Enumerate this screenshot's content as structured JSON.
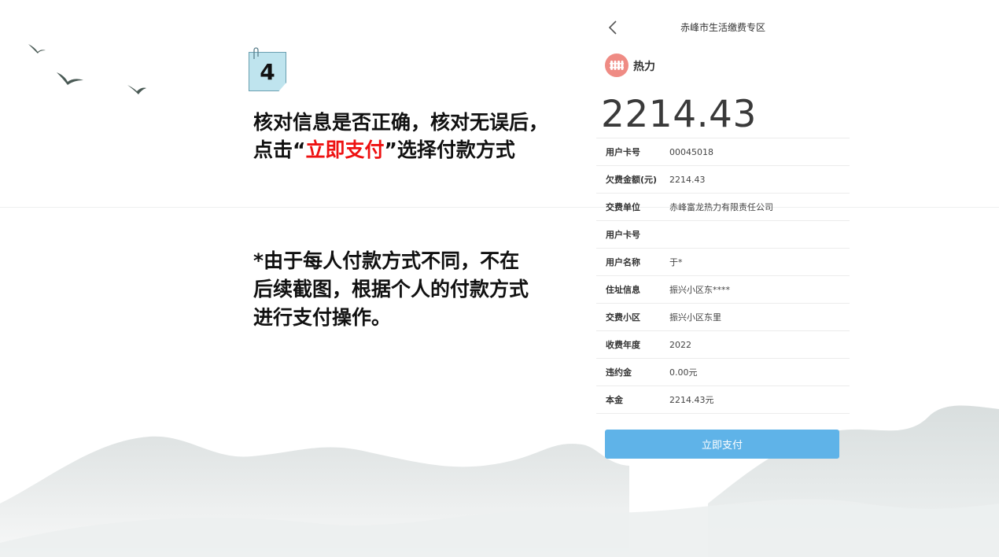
{
  "step": {
    "number": "4"
  },
  "instruction": {
    "line1": "核对信息是否正确，核对无误后，",
    "line2_prefix": "点击“",
    "line2_highlight": "立即支付",
    "line2_suffix": "”选择付款方式"
  },
  "note": {
    "line1": "*由于每人付款方式不同，不在",
    "line2": "后续截图，根据个人的付款方式",
    "line3": "进行支付操作。"
  },
  "app": {
    "title": "赤峰市生活缴费专区",
    "service_name": "热力",
    "amount": "2214.43",
    "rows": [
      {
        "label": "用户卡号",
        "value": "00045018"
      },
      {
        "label": "欠费金额(元)",
        "value": "2214.43"
      },
      {
        "label": "交费单位",
        "value": "赤峰富龙热力有限责任公司"
      },
      {
        "label": "用户卡号",
        "value": ""
      },
      {
        "label": "用户名称",
        "value": "于*"
      },
      {
        "label": "住址信息",
        "value": "振兴小区东****"
      },
      {
        "label": "交费小区",
        "value": "振兴小区东里"
      },
      {
        "label": "收费年度",
        "value": "2022"
      },
      {
        "label": "违约金",
        "value": "0.00元"
      },
      {
        "label": "本金",
        "value": "2214.43元"
      }
    ],
    "pay_button": "立即支付"
  },
  "colors": {
    "highlight": "#ee1111",
    "pay_button": "#5fb3e8",
    "service_icon": "#ef8b84",
    "note_paper": "#bfe4ee"
  },
  "icons": {
    "back": "chevron-left-icon",
    "service": "heating-radiator-icon",
    "decor": "bird-icon"
  }
}
